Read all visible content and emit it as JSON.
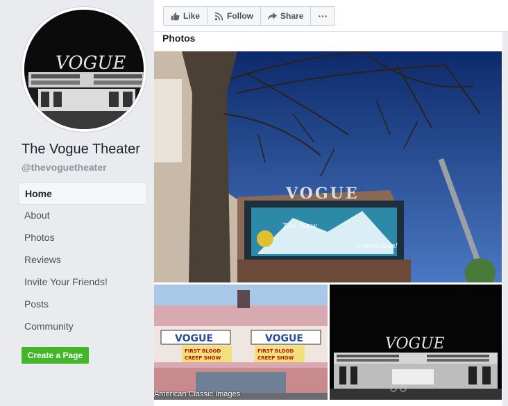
{
  "sidebar": {
    "page_name": "The Vogue Theater",
    "handle": "@thevoguetheater",
    "nav": [
      {
        "label": "Home",
        "active": true
      },
      {
        "label": "About"
      },
      {
        "label": "Photos"
      },
      {
        "label": "Reviews"
      },
      {
        "label": "Invite Your Friends!"
      },
      {
        "label": "Posts"
      },
      {
        "label": "Community"
      }
    ],
    "create_page": "Create a Page"
  },
  "actions": {
    "like": "Like",
    "follow": "Follow",
    "share": "Share",
    "more": "···"
  },
  "photos": {
    "title": "Photos",
    "marquee_name": "VOGUE",
    "marquee_show_1": "FIRST BLOOD",
    "marquee_show_2": "CREEP SHOW",
    "watermark": "American Classic Images",
    "marquee_text": "The New",
    "marquee_sub": "coming soon!"
  },
  "colors": {
    "create_button": "#42b72a",
    "background": "#e9ebee"
  }
}
